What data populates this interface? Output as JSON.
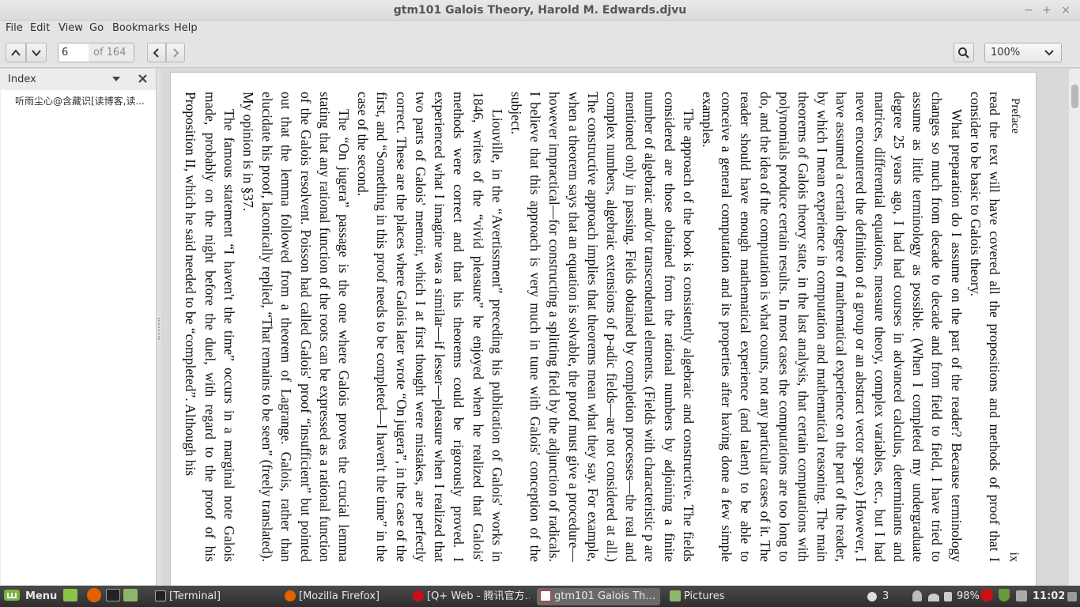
{
  "window": {
    "title": "gtm101  Galois Theory, Harold M. Edwards.djvu",
    "minimize": "−",
    "maximize": "+",
    "close": "×"
  },
  "menu": [
    "File",
    "Edit",
    "View",
    "Go",
    "Bookmarks",
    "Help"
  ],
  "toolbar": {
    "page_value": "6",
    "page_count": "of 164",
    "zoom": "100%"
  },
  "sidebar": {
    "title": "Index",
    "items": [
      "听雨尘心@含藏识[读博客,读..."
    ]
  },
  "page": {
    "running_head": "Preface",
    "page_number": "ix",
    "paragraphs": [
      "read the text will have covered all the propositions and methods of proof that I consider to be basic to Galois theory.",
      "What preparation do I assume on the part of the reader? Because terminology changes so much from decade to decade and from field to field, I have tried to assume as little terminology as possible. (When I completed my undergraduate degree 25 years ago, I had had courses in advanced calculus, determinants and matrices, differential equations, measure theory, complex variables, etc., but I had never encountered the definition of a group or an abstract vector space.) However, I have assumed a certain degree of mathematical experience on the part of the reader, by which I mean experience in computation and mathematical reasoning. The main theorems of Galois theory state, in the last analysis, that certain computations with polynomials produce certain results. In most cases the computations are too long to do, and the idea of the computation is what counts, not any particular cases of it. The reader should have enough mathematical experience (and talent) to be able to conceive a general computation and its properties after having done a few simple examples.",
      "The approach of the book is consistently algebraic and constructive. The fields considered are those obtained from the rational numbers by adjoining a finite number of algebraic and/or transcendental elements. (Fields with characteristic p are mentioned only in passing. Fields obtained by completion processes—the real and complex numbers, algebraic extensions of p-adic fields—are not considered at all.) The constructive approach implies that theorems mean what they say. For example, when a theorem says that an equation is solvable, the proof must give a procedure—however impractical—for constructing a splitting field by the adjunction of radicals. I believe that this approach is very much in tune with Galois' conception of the subject.",
      "Liouville, in the “Avertissment” preceding his publication of Galois' works in 1846, writes of the “vivid pleasure” he enjoyed when he realized that Galois' methods were correct and that his theorems could be rigorously proved. I experienced what I imagine was a similar—if lesser—pleasure when I realized that two parts of Galois' memoir, which I at first thought were mistakes, are perfectly correct. These are the places where Galois later wrote “On jugera”, in the case of the first, and “Something in this proof needs to be completed—I haven't the time” in the case of the second.",
      "The “On jugera” passage is the one where Galois proves the crucial lemma stating that any rational function of the roots can be expressed as a rational function of the Galois resolvent. Poisson had called Galois' proof “insufficient” but pointed out that the lemma followed from a theorem of Lagrange. Galois, rather than elucidate his proof, laconically replied, “That remains to be seen” (freely translated). My opinion is in §37.",
      "The famous statement “I haven't the time” occurs in a marginal note Galois made, probably on the night before the duel, with regard to the proof of his Proposition II, which he said needed to be “completed”. Although his"
    ]
  },
  "taskbar": {
    "menu_label": "Menu",
    "tasks": [
      "[Terminal]",
      "[Mozilla Firefox]",
      "[Q+ Web - 腾讯官方…",
      "gtm101  Galois Th…",
      "Pictures"
    ],
    "notification_count": "3",
    "battery": "98%",
    "clock": "11:02"
  }
}
